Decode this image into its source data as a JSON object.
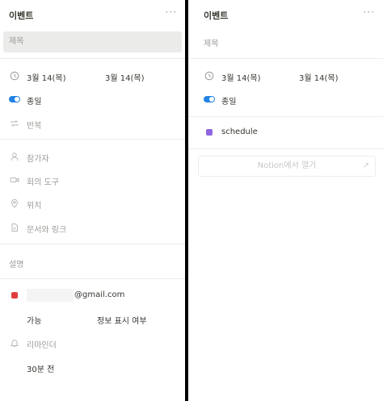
{
  "left": {
    "header": {
      "title": "이벤트",
      "more": "···"
    },
    "title_placeholder": "제목",
    "date": {
      "start": "3월 14(목)",
      "end": "3월 14(목)"
    },
    "allday_label": "종일",
    "repeat_label": "반복",
    "participants_label": "참가자",
    "meeting_tool_label": "회의 도구",
    "location_label": "위치",
    "docs_label": "문서와 링크",
    "description_label": "설명",
    "calendar": {
      "email_suffix": "@gmail.com",
      "color": "#e03e3e"
    },
    "availability": {
      "status": "가능",
      "visibility": "정보 표시 여부"
    },
    "reminder_label": "리마인더",
    "reminder_value": "30분 전"
  },
  "right": {
    "header": {
      "title": "이벤트",
      "more": "···"
    },
    "title_placeholder": "제목",
    "date": {
      "start": "3월 14(목)",
      "end": "3월 14(목)"
    },
    "allday_label": "종일",
    "calendar_name": "schedule",
    "calendar_color": "#9065e0",
    "open_in_notion": "Notion에서 열기"
  }
}
